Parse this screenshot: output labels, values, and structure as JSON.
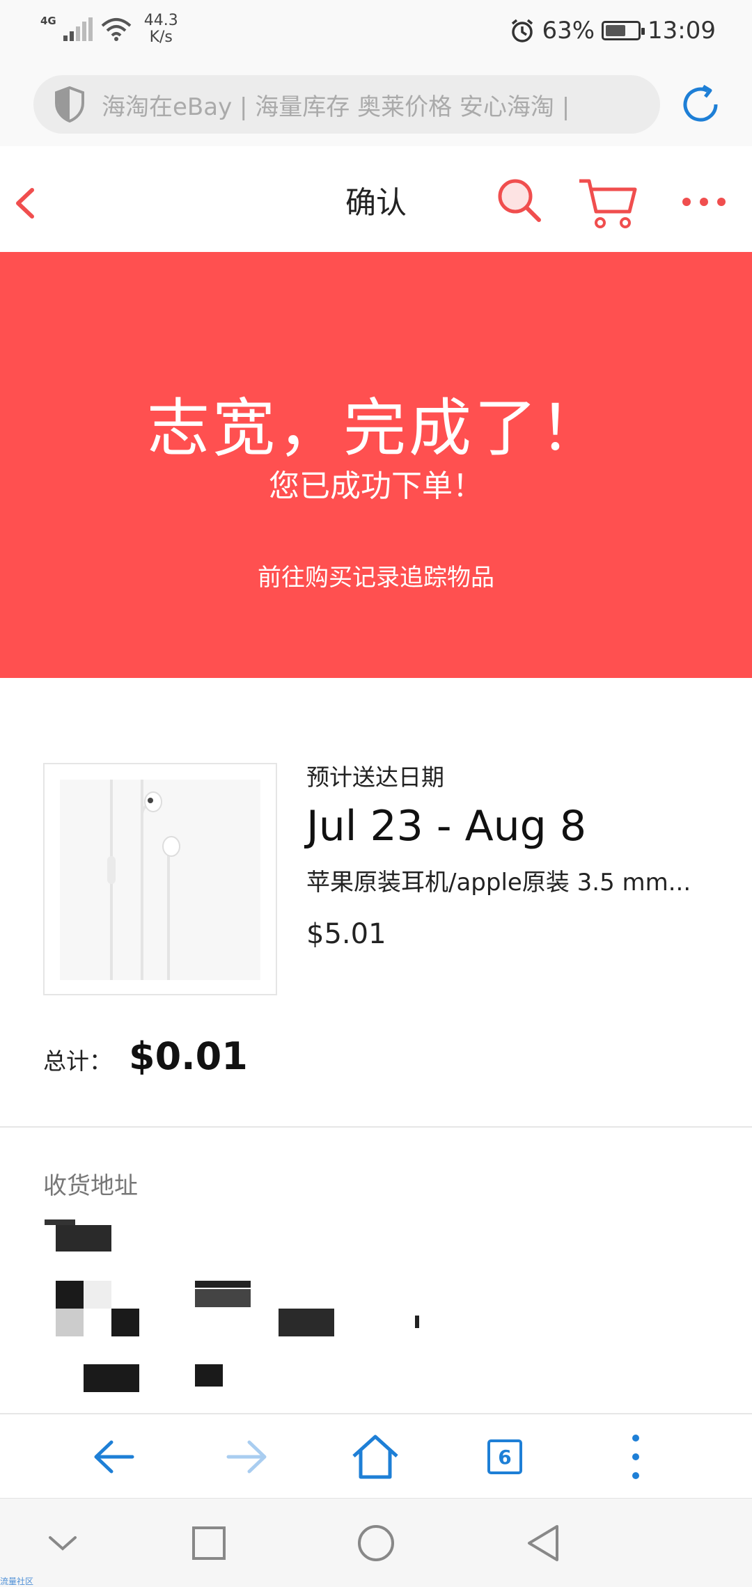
{
  "status_bar": {
    "network": "4G",
    "speed_value": "44.3",
    "speed_unit": "K/s",
    "battery": "63%",
    "time": "13:09"
  },
  "browser": {
    "url_placeholder": "海淘在eBay | 海量库存 奥莱价格 安心海淘 |",
    "tabs_count": "6"
  },
  "header": {
    "title": "确认"
  },
  "banner": {
    "headline": "志宽，完成了！",
    "subtitle": "您已成功下单！",
    "link": "前往购买记录追踪物品"
  },
  "order": {
    "eta_label": "预计送达日期",
    "eta": "Jul 23 - Aug 8",
    "product_title": "苹果原装耳机/apple原装 3.5 mm...",
    "price": "$5.01",
    "total_label": "总计：",
    "total_value": "$0.01"
  },
  "address": {
    "title": "收货地址"
  },
  "watermark": "流量社区",
  "colors": {
    "accent": "#ff5050",
    "icon_red": "#f04e4e",
    "icon_blue": "#1e7fd6"
  }
}
